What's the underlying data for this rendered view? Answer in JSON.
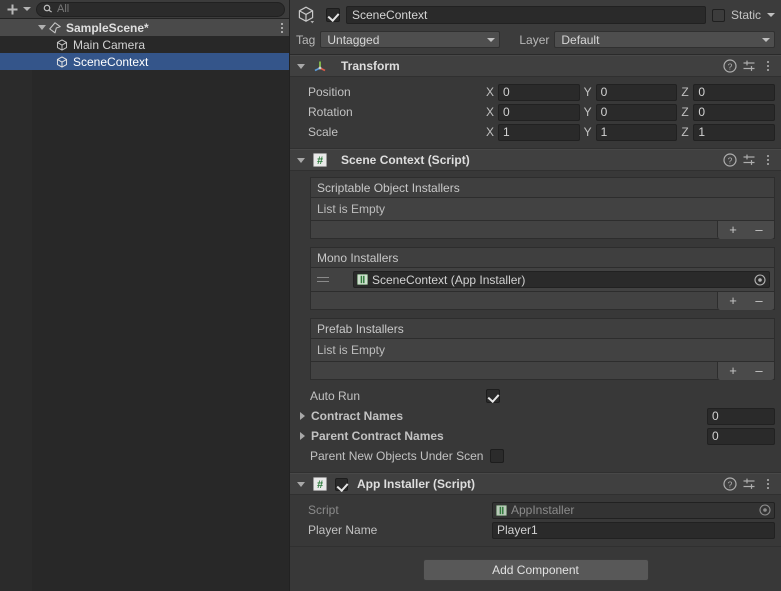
{
  "hierarchy": {
    "toolbar": {
      "add_label": "+",
      "add_icon": "plus-icon",
      "dropdown_icon": "chevron-down-icon",
      "search_icon": "search-icon",
      "search_placeholder": "All",
      "search_value": ""
    },
    "rows": [
      {
        "label": "SampleScene*",
        "icon": "unity-scene-icon",
        "indent": 0,
        "expanded": true,
        "selected": false,
        "kind": "scene",
        "menu_icon": "kebab-menu-icon"
      },
      {
        "label": "Main Camera",
        "icon": "gameobject-cube-icon",
        "indent": 1,
        "expanded": false,
        "selected": false,
        "kind": "object"
      },
      {
        "label": "SceneContext",
        "icon": "gameobject-cube-icon",
        "indent": 1,
        "expanded": false,
        "selected": true,
        "kind": "object"
      }
    ]
  },
  "inspector": {
    "header": {
      "object_icon": "gameobject-cube-icon",
      "enabled": true,
      "name": "SceneContext",
      "static_label": "Static",
      "static_checked": false,
      "tag_label": "Tag",
      "tag_value": "Untagged",
      "layer_label": "Layer",
      "layer_value": "Default"
    },
    "components": [
      {
        "id": "transform",
        "title": "Transform",
        "icon": "transform-axis-icon",
        "expanded": true,
        "has_enable_toggle": false,
        "help_icon": "help-icon",
        "preset_icon": "preset-settings-icon",
        "menu_icon": "kebab-menu-icon",
        "rows": [
          {
            "label": "Position",
            "axes": [
              "X",
              "Y",
              "Z"
            ],
            "values": [
              "0",
              "0",
              "0"
            ]
          },
          {
            "label": "Rotation",
            "axes": [
              "X",
              "Y",
              "Z"
            ],
            "values": [
              "0",
              "0",
              "0"
            ]
          },
          {
            "label": "Scale",
            "axes": [
              "X",
              "Y",
              "Z"
            ],
            "values": [
              "1",
              "1",
              "1"
            ]
          }
        ]
      },
      {
        "id": "scene-context",
        "title": "Scene Context (Script)",
        "icon": "cs-script-icon",
        "expanded": true,
        "has_enable_toggle": false,
        "help_icon": "help-icon",
        "preset_icon": "preset-settings-icon",
        "menu_icon": "kebab-menu-icon",
        "lists": [
          {
            "header": "Scriptable Object Installers",
            "empty_text": "List is Empty",
            "items": [],
            "add_label": "+",
            "remove_label": "–"
          },
          {
            "header": "Mono Installers",
            "empty_text": "",
            "items": [
              {
                "text": "SceneContext (App Installer)",
                "icon": "script-asset-icon",
                "picker_icon": "object-picker-icon",
                "drag_icon": "drag-handle-icon"
              }
            ],
            "add_label": "+",
            "remove_label": "–"
          },
          {
            "header": "Prefab Installers",
            "empty_text": "List is Empty",
            "items": [],
            "add_label": "+",
            "remove_label": "–"
          }
        ],
        "fields": [
          {
            "kind": "checkbox",
            "label": "Auto Run",
            "checked": true
          },
          {
            "kind": "array",
            "label": "Contract Names",
            "expanded": false,
            "size": "0",
            "foldout_icon": "chevron-right-icon"
          },
          {
            "kind": "array",
            "label": "Parent Contract Names",
            "expanded": false,
            "size": "0",
            "foldout_icon": "chevron-right-icon"
          },
          {
            "kind": "checkbox",
            "label": "Parent New Objects Under Scen",
            "checked": false
          }
        ]
      },
      {
        "id": "app-installer",
        "title": "App Installer (Script)",
        "icon": "cs-script-icon",
        "expanded": true,
        "has_enable_toggle": true,
        "enabled": true,
        "help_icon": "help-icon",
        "preset_icon": "preset-settings-icon",
        "menu_icon": "kebab-menu-icon",
        "fields": [
          {
            "kind": "object",
            "label": "Script",
            "value": "AppInstaller",
            "disabled": true,
            "icon": "script-asset-icon",
            "picker_icon": "object-picker-icon"
          },
          {
            "kind": "text",
            "label": "Player Name",
            "value": "Player1"
          }
        ]
      }
    ],
    "add_component_label": "Add Component"
  },
  "colors": {
    "panel_bg": "#383838",
    "header_bg": "#3c3c3c",
    "component_header_bg": "#404040",
    "field_bg": "#2a2a2a",
    "selection_blue": "#34558a",
    "hierarchy_bg": "#282828",
    "list_bg": "#424242",
    "button_bg": "#585858",
    "text": "#c4c4c4"
  }
}
